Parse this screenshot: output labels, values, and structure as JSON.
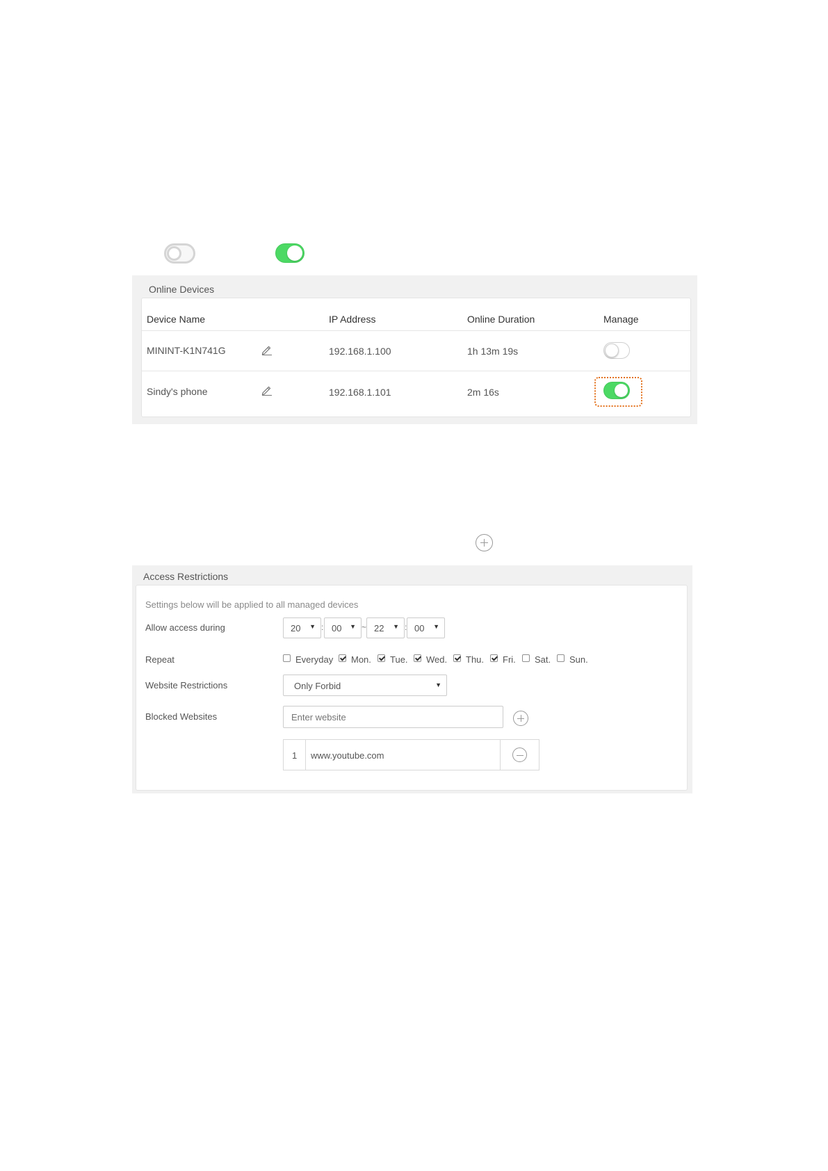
{
  "online_devices": {
    "title": "Online Devices",
    "columns": [
      "Device Name",
      "IP Address",
      "Online Duration",
      "Manage"
    ],
    "rows": [
      {
        "name": "MININT-K1N741G",
        "ip": "192.168.1.100",
        "duration": "1h 13m 19s",
        "manage": "off"
      },
      {
        "name": "Sindy's phone",
        "ip": "192.168.1.101",
        "duration": "2m 16s",
        "manage": "on"
      }
    ]
  },
  "access_restrictions": {
    "title": "Access Restrictions",
    "hint": "Settings below will be applied to all managed devices",
    "allow_label": "Allow access during",
    "time": {
      "start_hour": "20",
      "start_min": "00",
      "end_hour": "22",
      "end_min": "00",
      "colon": ":",
      "tilde": "~"
    },
    "repeat_label": "Repeat",
    "days": [
      {
        "label": "Everyday",
        "checked": false
      },
      {
        "label": "Mon.",
        "checked": true
      },
      {
        "label": "Tue.",
        "checked": true
      },
      {
        "label": "Wed.",
        "checked": true
      },
      {
        "label": "Thu.",
        "checked": true
      },
      {
        "label": "Fri.",
        "checked": true
      },
      {
        "label": "Sat.",
        "checked": false
      },
      {
        "label": "Sun.",
        "checked": false
      }
    ],
    "website_label": "Website Restrictions",
    "website_mode": "Only Forbid",
    "blocked_label": "Blocked Websites",
    "website_placeholder": "Enter website",
    "blocked_list": [
      {
        "index": "1",
        "url": "www.youtube.com"
      }
    ]
  },
  "colors": {
    "toggle_on": "#4cd964",
    "highlight": "#e3701a"
  },
  "icons": {
    "edit": "pencil-icon",
    "add": "plus-circle-icon",
    "remove": "minus-circle-icon",
    "dropdown": "caret-down-icon"
  }
}
